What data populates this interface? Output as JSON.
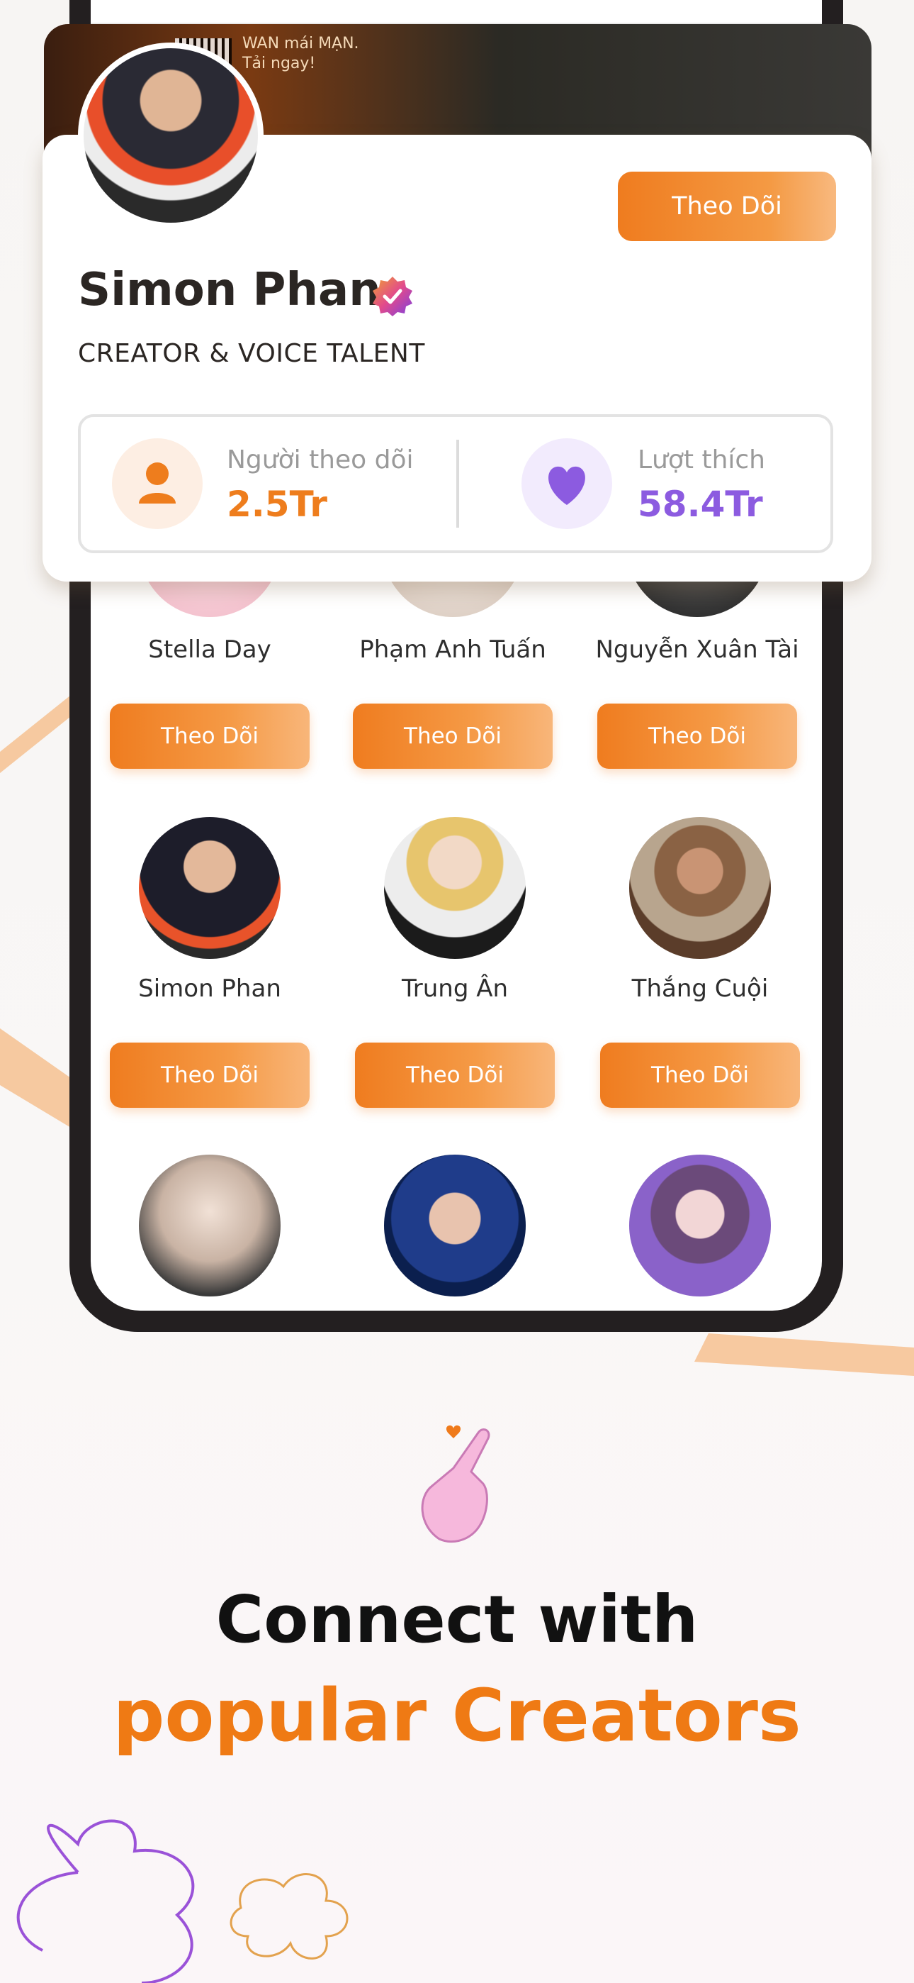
{
  "banner": {
    "line1": "WAN mái MẠN.",
    "line2": "Tải ngay!"
  },
  "profile": {
    "name": "Simon Phan",
    "title": "CREATOR & VOICE TALENT",
    "follow_label": "Theo Dõi",
    "followers_label": "Người theo dõi",
    "followers_value": "2.5Tr",
    "likes_label": "Lượt thích",
    "likes_value": "58.4Tr"
  },
  "creators": [
    {
      "name": "Stella Day",
      "follow_label": "Theo Dõi"
    },
    {
      "name": "Phạm Anh Tuấn",
      "follow_label": "Theo Dõi"
    },
    {
      "name": "Nguyễn Xuân Tài",
      "follow_label": "Theo Dõi"
    },
    {
      "name": "Simon Phan",
      "follow_label": "Theo Dõi"
    },
    {
      "name": "Trung Ân",
      "follow_label": "Theo Dõi"
    },
    {
      "name": "Thắng Cuội",
      "follow_label": "Theo Dõi"
    },
    {
      "name": "",
      "follow_label": ""
    },
    {
      "name": "",
      "follow_label": ""
    },
    {
      "name": "",
      "follow_label": ""
    }
  ],
  "marketing": {
    "headline_line1": "Connect with",
    "headline_line2": "popular Creators"
  },
  "colors": {
    "accent_orange": "#ef7c1f",
    "likes_purple": "#8c5be0",
    "text_dark": "#2b2623"
  },
  "icons": {
    "follower": "person-icon",
    "likes": "heart-icon",
    "verified": "verified-badge-icon",
    "hand": "finger-heart-hand-icon"
  }
}
